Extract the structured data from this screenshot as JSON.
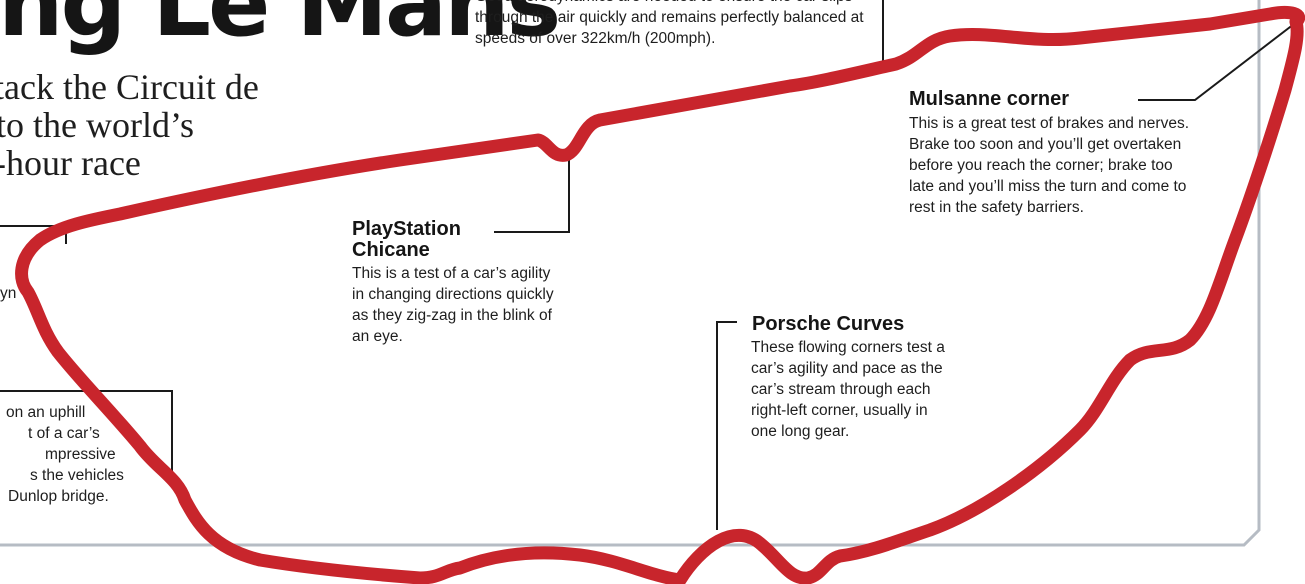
{
  "header": {
    "title": "ng Le Mans",
    "subtitle_lines": [
      "tack the Circuit de",
      "to the world’s",
      "-hour race"
    ]
  },
  "aero": {
    "heading": "",
    "body": "Good aerodynamics are needed to ensure the car slips through the air quickly and remains perfectly balanced at speeds of over 322km/h (200mph)."
  },
  "mulsanne": {
    "heading": "Mulsanne corner",
    "body": "This is a great test of brakes and nerves. Brake too soon and you’ll get overtaken before you reach the corner; brake too late and you’ll miss the turn and come to rest in the safety barriers."
  },
  "playstation": {
    "heading_line1": "PlayStation",
    "heading_line2": "Chicane",
    "body": "This is a test of a car’s agility in changing directions quickly as they zig-zag in the blink of an eye."
  },
  "porsche": {
    "heading": "Porsche Curves",
    "body": "These flowing corners test a car’s agility and pace as the car’s stream through each right-left corner, usually in one long gear."
  },
  "left_partial": {
    "fragment": "yn"
  },
  "dunlop": {
    "lines": [
      "on an uphill",
      "t of a car’s",
      "mpressive",
      "s the vehicles",
      "Dunlop bridge."
    ]
  },
  "colors": {
    "track": "#c8252c",
    "track_edge": "#a51d24",
    "callout_line": "#1a1a1a",
    "panel_border": "#b6bcc4"
  }
}
